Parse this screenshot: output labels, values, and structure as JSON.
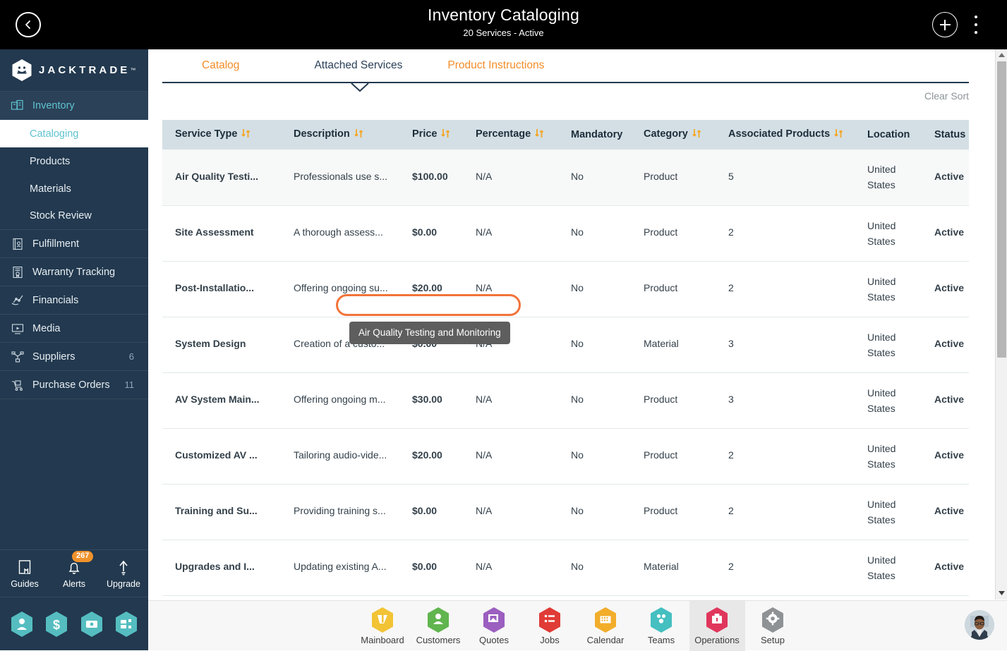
{
  "header": {
    "title": "Inventory Cataloging",
    "subtitle": "20 Services - Active",
    "back_icon": "chevron-left-icon",
    "add_icon": "plus-icon",
    "menu_icon": "kebab-menu-icon"
  },
  "sidebar": {
    "brand": "JACKTRADE",
    "brand_tm": "™",
    "groups": [
      {
        "label": "Inventory",
        "icon": "inventory-icon",
        "active": true,
        "badge": "",
        "children": [
          {
            "label": "Cataloging",
            "active": true
          },
          {
            "label": "Products",
            "active": false
          },
          {
            "label": "Materials",
            "active": false
          },
          {
            "label": "Stock Review",
            "active": false
          }
        ]
      },
      {
        "label": "Fulfillment",
        "icon": "fulfillment-icon",
        "active": false,
        "badge": "",
        "children": []
      },
      {
        "label": "Warranty Tracking",
        "icon": "warranty-icon",
        "active": false,
        "badge": "",
        "children": []
      },
      {
        "label": "Financials",
        "icon": "financials-icon",
        "active": false,
        "badge": "",
        "children": []
      },
      {
        "label": "Media",
        "icon": "media-icon",
        "active": false,
        "badge": "",
        "children": []
      },
      {
        "label": "Suppliers",
        "icon": "suppliers-icon",
        "active": false,
        "badge": "6",
        "children": []
      },
      {
        "label": "Purchase Orders",
        "icon": "purchase-orders-icon",
        "active": false,
        "badge": "11",
        "children": []
      }
    ],
    "tools": [
      {
        "label": "Guides",
        "icon": "book-icon",
        "badge": ""
      },
      {
        "label": "Alerts",
        "icon": "bell-icon",
        "badge": "267"
      },
      {
        "label": "Upgrade",
        "icon": "up-arrow-icon",
        "badge": ""
      }
    ],
    "quick_hexes": [
      {
        "icon": "person-hex-icon"
      },
      {
        "icon": "dollar-hex-icon"
      },
      {
        "icon": "payment-hex-icon"
      },
      {
        "icon": "workflow-hex-icon"
      }
    ]
  },
  "main": {
    "tabs": [
      {
        "label": "Catalog",
        "active": false
      },
      {
        "label": "Attached Services",
        "active": true
      },
      {
        "label": "Product Instructions",
        "active": false
      }
    ],
    "clear_sort": "Clear Sort",
    "table": {
      "columns": [
        {
          "label": "Service Type",
          "sortable": true
        },
        {
          "label": "Description",
          "sortable": true
        },
        {
          "label": "Price",
          "sortable": true
        },
        {
          "label": "Percentage",
          "sortable": true
        },
        {
          "label": "Mandatory",
          "sortable": false
        },
        {
          "label": "Category",
          "sortable": true
        },
        {
          "label": "Associated Products",
          "sortable": true
        },
        {
          "label": "Location",
          "sortable": false
        },
        {
          "label": "Status",
          "sortable": false
        }
      ],
      "rows": [
        {
          "service_type": "Air Quality Testi...",
          "description": "Professionals use s...",
          "price": "$100.00",
          "percentage": "N/A",
          "mandatory": "No",
          "category": "Product",
          "associated_products": "5",
          "location": "United States",
          "status": "Active",
          "hovered": true
        },
        {
          "service_type": "Site Assessment",
          "description": "A thorough assess...",
          "price": "$0.00",
          "percentage": "N/A",
          "mandatory": "No",
          "category": "Product",
          "associated_products": "2",
          "location": "United States",
          "status": "Active",
          "hovered": false
        },
        {
          "service_type": "Post-Installatio...",
          "description": "Offering ongoing su...",
          "price": "$20.00",
          "percentage": "N/A",
          "mandatory": "No",
          "category": "Product",
          "associated_products": "2",
          "location": "United States",
          "status": "Active",
          "hovered": false
        },
        {
          "service_type": "System Design",
          "description": "Creation of a custo...",
          "price": "$0.00",
          "percentage": "N/A",
          "mandatory": "No",
          "category": "Material",
          "associated_products": "3",
          "location": "United States",
          "status": "Active",
          "hovered": false
        },
        {
          "service_type": "AV System Main...",
          "description": "Offering ongoing m...",
          "price": "$30.00",
          "percentage": "N/A",
          "mandatory": "No",
          "category": "Product",
          "associated_products": "3",
          "location": "United States",
          "status": "Active",
          "hovered": false
        },
        {
          "service_type": "Customized AV ...",
          "description": "Tailoring audio-vide...",
          "price": "$20.00",
          "percentage": "N/A",
          "mandatory": "No",
          "category": "Product",
          "associated_products": "2",
          "location": "United States",
          "status": "Active",
          "hovered": false
        },
        {
          "service_type": "Training and Su...",
          "description": "Providing training s...",
          "price": "$0.00",
          "percentage": "N/A",
          "mandatory": "No",
          "category": "Product",
          "associated_products": "2",
          "location": "United States",
          "status": "Active",
          "hovered": false
        },
        {
          "service_type": "Upgrades and I...",
          "description": "Updating existing A...",
          "price": "$0.00",
          "percentage": "N/A",
          "mandatory": "No",
          "category": "Material",
          "associated_products": "2",
          "location": "United States",
          "status": "Active",
          "hovered": false
        }
      ]
    },
    "tooltip": "Air Quality Testing and Monitoring"
  },
  "bottom_nav": {
    "items": [
      {
        "label": "Mainboard",
        "icon": "mainboard-hex-icon",
        "color": "#f2c335",
        "selected": false
      },
      {
        "label": "Customers",
        "icon": "customers-hex-icon",
        "color": "#61b54e",
        "selected": false
      },
      {
        "label": "Quotes",
        "icon": "quotes-hex-icon",
        "color": "#9b5fc0",
        "selected": false
      },
      {
        "label": "Jobs",
        "icon": "jobs-hex-icon",
        "color": "#e03b36",
        "selected": false
      },
      {
        "label": "Calendar",
        "icon": "calendar-hex-icon",
        "color": "#f2ad2b",
        "selected": false
      },
      {
        "label": "Teams",
        "icon": "teams-hex-icon",
        "color": "#45bfc0",
        "selected": false
      },
      {
        "label": "Operations",
        "icon": "operations-hex-icon",
        "color": "#e0365c",
        "selected": true
      },
      {
        "label": "Setup",
        "icon": "setup-hex-icon",
        "color": "#8e9295",
        "selected": false
      }
    ],
    "avatar": "user-avatar"
  },
  "scrollbar": {
    "up_icon": "scroll-up-icon",
    "down_icon": "scroll-down-icon"
  },
  "colors": {
    "accent_orange": "#f28c28",
    "highlight_ring": "#f2733a",
    "sidebar_bg": "#22394f",
    "sidebar_active_text": "#5fc3cf",
    "table_header_bg": "#d3dfe4",
    "status_active": "#4a9c3c"
  }
}
